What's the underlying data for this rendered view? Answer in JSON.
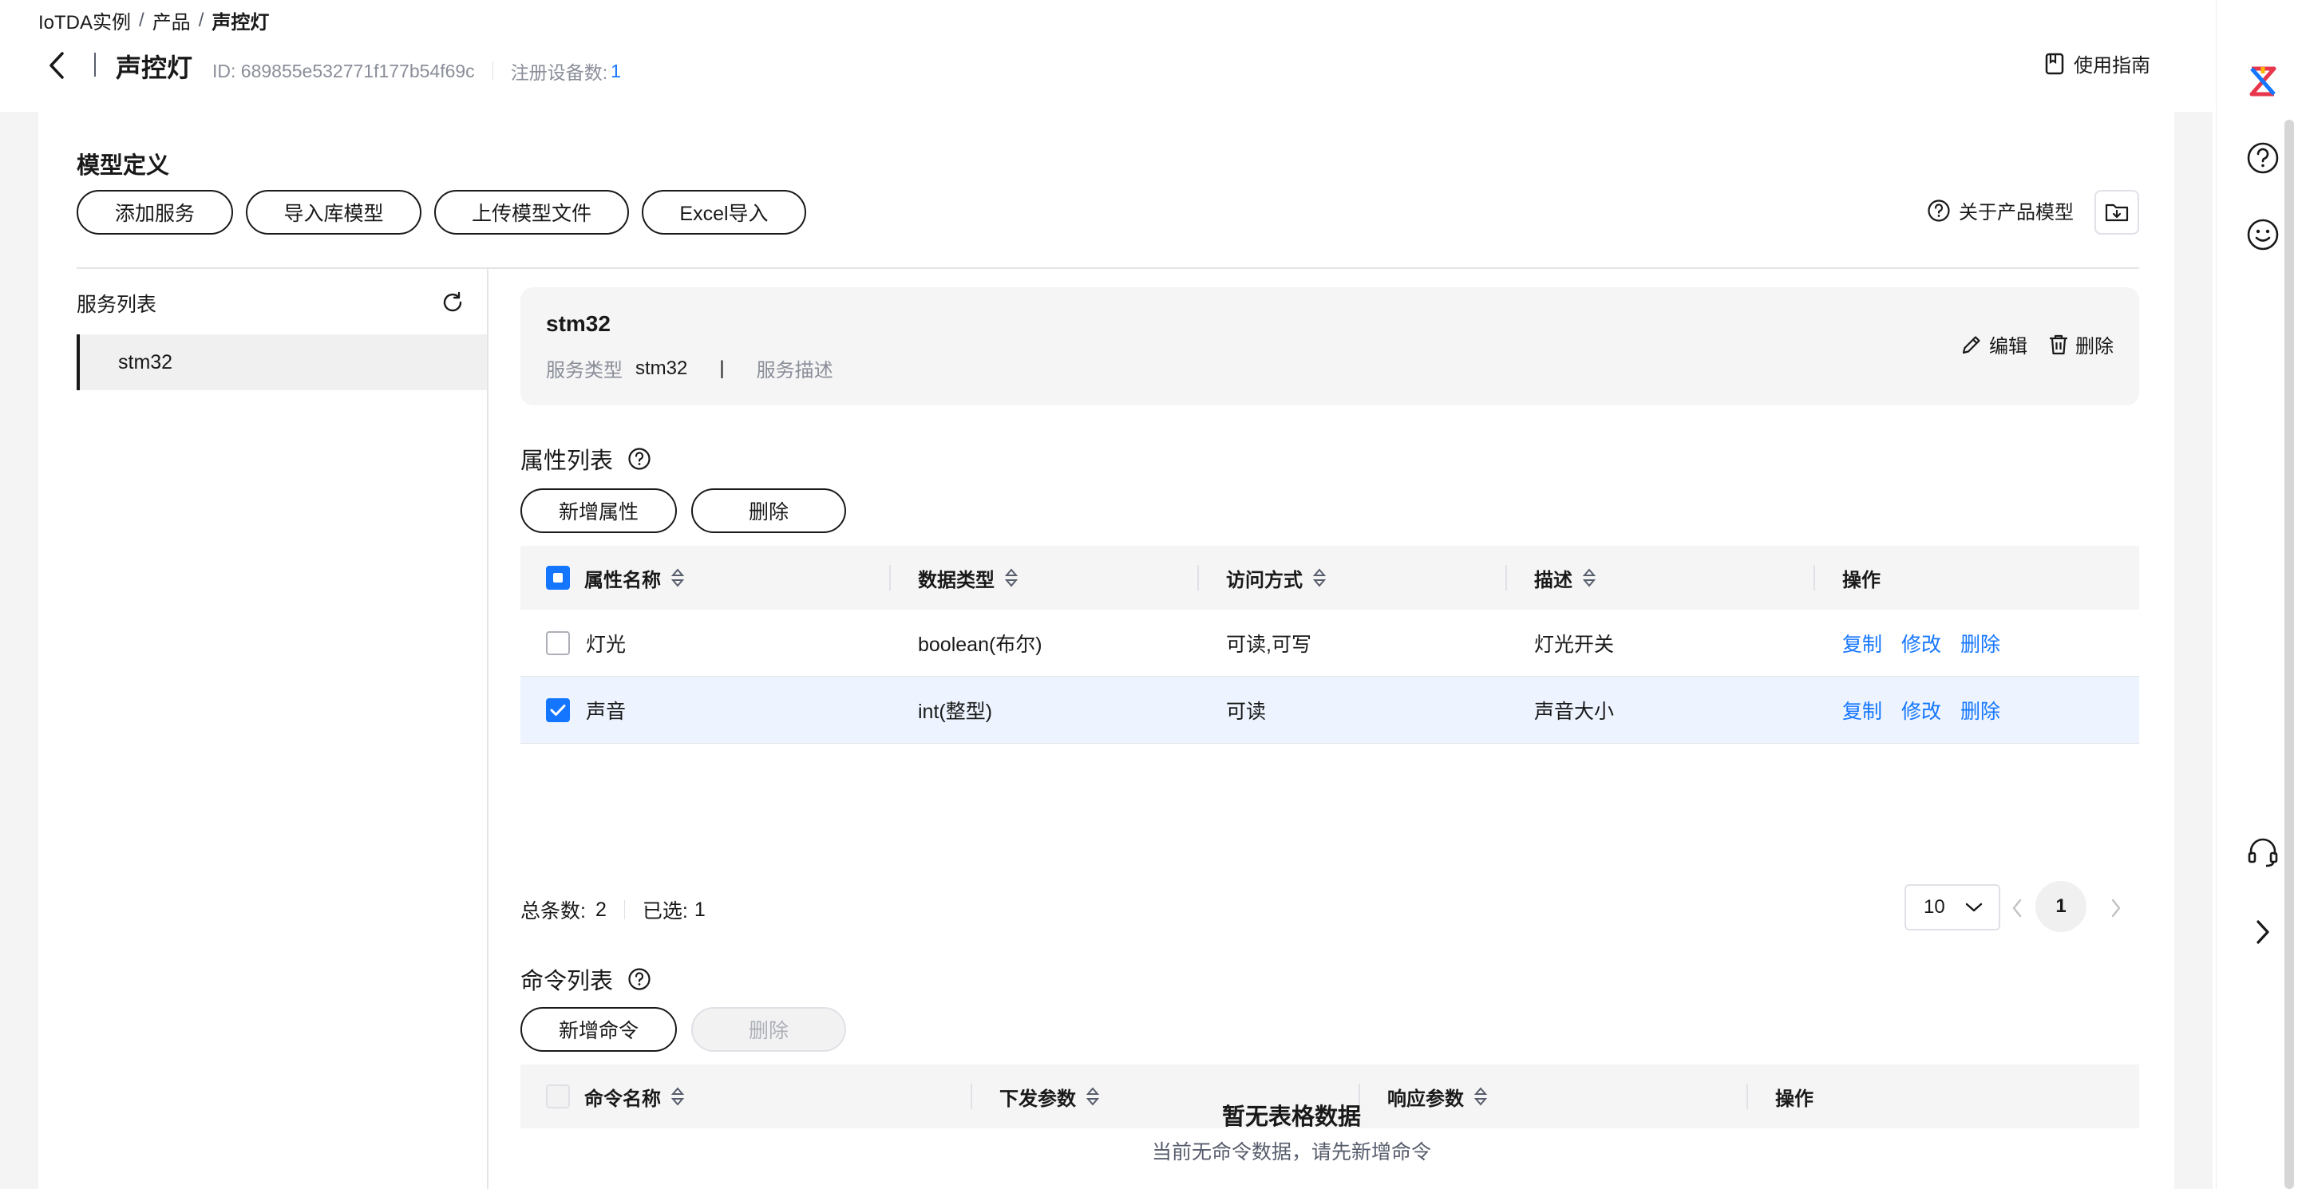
{
  "breadcrumb": {
    "root": "IoTDA实例",
    "sep": "/",
    "middle": "产品",
    "current": "声控灯"
  },
  "header": {
    "title": "声控灯",
    "id_text": "ID: 689855e532771f177b54f69c",
    "registered_label": "注册设备数:",
    "registered_count": "1",
    "guide_label": "使用指南"
  },
  "model": {
    "title": "模型定义",
    "buttons": {
      "add_service": "添加服务",
      "import_lib": "导入库模型",
      "upload_file": "上传模型文件",
      "excel_import": "Excel导入"
    },
    "about_label": "关于产品模型"
  },
  "service_list": {
    "title": "服务列表",
    "items": [
      {
        "label": "stm32",
        "selected": true
      }
    ]
  },
  "service": {
    "name": "stm32",
    "type_label": "服务类型",
    "type_value": "stm32",
    "bar": "|",
    "desc_label": "服务描述",
    "edit_label": "编辑",
    "delete_label": "删除"
  },
  "properties": {
    "title": "属性列表",
    "add_label": "新增属性",
    "delete_label": "删除",
    "columns": {
      "name": "属性名称",
      "type": "数据类型",
      "access": "访问方式",
      "desc": "描述",
      "ops": "操作"
    },
    "rows": [
      {
        "name": "灯光",
        "type": "boolean(布尔)",
        "access": "可读,可写",
        "desc": "灯光开关",
        "copy": "复制",
        "edit": "修改",
        "del": "删除",
        "checked": false
      },
      {
        "name": "声音",
        "type": "int(整型)",
        "access": "可读",
        "desc": "声音大小",
        "copy": "复制",
        "edit": "修改",
        "del": "删除",
        "checked": true
      }
    ],
    "total_label": "总条数:",
    "total": "2",
    "selected_label": "已选:",
    "selected": "1",
    "page_size": "10",
    "current_page": "1"
  },
  "commands": {
    "title": "命令列表",
    "add_label": "新增命令",
    "delete_label": "删除",
    "columns": {
      "name": "命令名称",
      "send": "下发参数",
      "resp": "响应参数",
      "ops": "操作"
    },
    "empty_title": "暂无表格数据",
    "empty_desc": "当前无命令数据，请先新增命令"
  },
  "colors": {
    "accent": "#1476ff",
    "text": "#191919",
    "muted": "#8a8e99",
    "selected_row": "#edf4ff"
  },
  "icons": [
    "back-arrow-icon",
    "book-icon",
    "help-icon",
    "folder-import-icon",
    "refresh-icon",
    "edit-icon",
    "trash-icon",
    "sort-icon",
    "chevron-down-icon",
    "chevron-left-icon",
    "chevron-right-icon",
    "logo-icon",
    "smile-icon",
    "headset-icon"
  ]
}
